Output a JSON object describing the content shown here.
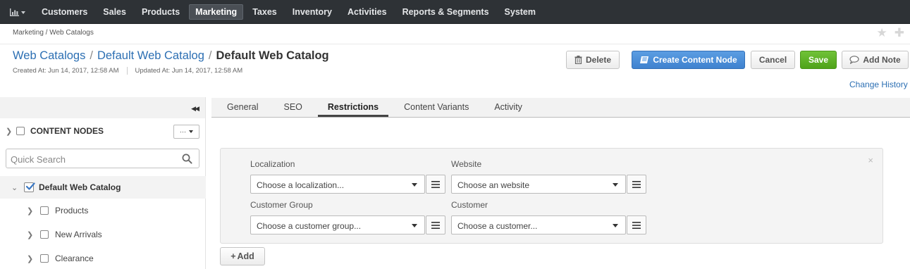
{
  "nav": {
    "items": [
      "Customers",
      "Sales",
      "Products",
      "Marketing",
      "Taxes",
      "Inventory",
      "Activities",
      "Reports & Segments",
      "System"
    ],
    "active": "Marketing"
  },
  "breadcrumb": "Marketing / Web Catalogs",
  "page": {
    "crumb1": "Web Catalogs",
    "crumb2": "Default Web Catalog",
    "sep": "/",
    "title": "Default Web Catalog",
    "created": "Created At: Jun 14, 2017, 12:58 AM",
    "updated": "Updated At: Jun 14, 2017, 12:58 AM"
  },
  "actions": {
    "delete": "Delete",
    "create": "Create Content Node",
    "cancel": "Cancel",
    "save": "Save",
    "add_note": "Add Note",
    "change_history": "Change History"
  },
  "sidebar": {
    "content_nodes": "CONTENT NODES",
    "dropdown": "···",
    "search_placeholder": "Quick Search",
    "root": "Default Web Catalog",
    "children": [
      "Products",
      "New Arrivals",
      "Clearance"
    ]
  },
  "tabs": [
    "General",
    "SEO",
    "Restrictions",
    "Content Variants",
    "Activity"
  ],
  "active_tab": "Restrictions",
  "restriction": {
    "localization_label": "Localization",
    "localization_value": "Choose a localization...",
    "website_label": "Website",
    "website_value": "Choose an website",
    "group_label": "Customer Group",
    "group_value": "Choose a customer group...",
    "customer_label": "Customer",
    "customer_value": "Choose a customer...",
    "close": "×"
  },
  "add_button": "Add",
  "colors": {
    "link": "#2c6fb3",
    "primary": "#4a8fdc",
    "success": "#5fb22a",
    "nav_bg": "#2e3236"
  }
}
